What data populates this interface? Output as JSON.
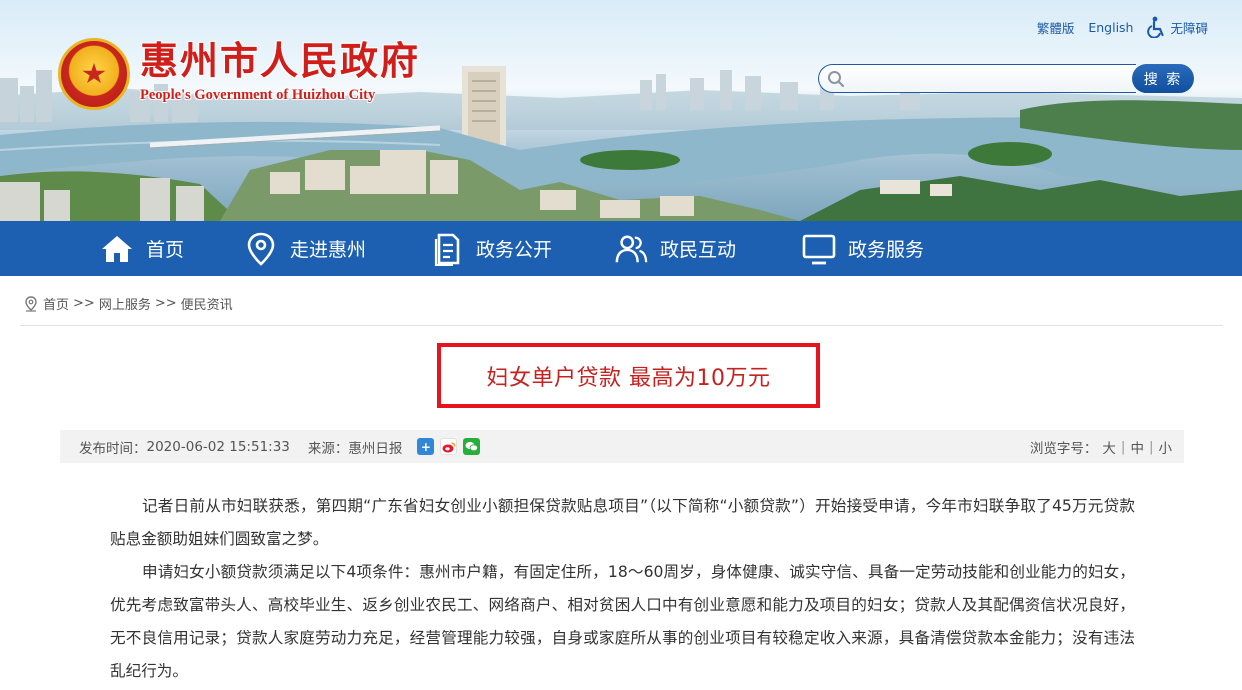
{
  "site": {
    "name_cn": "惠州市人民政府",
    "name_en": "People's Government of Huizhou City"
  },
  "toplinks": {
    "traditional": "繁體版",
    "english": "English",
    "accessibility": "无障碍"
  },
  "search": {
    "placeholder": "",
    "button_label": "搜 索"
  },
  "nav": {
    "items": [
      {
        "label": "首页",
        "icon": "home-icon"
      },
      {
        "label": "走进惠州",
        "icon": "location-pin-icon"
      },
      {
        "label": "政务公开",
        "icon": "document-icon"
      },
      {
        "label": "政民互动",
        "icon": "users-icon"
      },
      {
        "label": "政务服务",
        "icon": "monitor-icon"
      }
    ]
  },
  "breadcrumb": {
    "items": [
      "首页",
      "网上服务",
      "便民资讯"
    ],
    "separator": ">>"
  },
  "article": {
    "title": "妇女单户贷款 最高为10万元",
    "publish_label": "发布时间：",
    "publish_time": "2020-06-02 15:51:33",
    "source_label": "来源：",
    "source": "惠州日报",
    "font_size_label": "浏览字号：",
    "font_sizes": [
      "大",
      "中",
      "小"
    ],
    "paragraphs": [
      "记者日前从市妇联获悉，第四期“广东省妇女创业小额担保贷款贴息项目”（以下简称“小额贷款”）开始接受申请，今年市妇联争取了45万元贷款贴息金额助姐妹们圆致富之梦。",
      "申请妇女小额贷款须满足以下4项条件：惠州市户籍，有固定住所，18～60周岁，身体健康、诚实守信、具备一定劳动技能和创业能力的妇女，优先考虑致富带头人、高校毕业生、返乡创业农民工、网络商户、相对贫困人口中有创业意愿和能力及项目的妇女；贷款人及其配偶资信状况良好，无不良信用记录；贷款人家庭劳动力充足，经营管理能力较强，自身或家庭所从事的创业项目有较稳定收入来源，具备清偿贷款本金能力；没有违法乱纪行为。"
    ]
  },
  "colors": {
    "nav_bg": "#1d5fb0",
    "brand_red": "#d01e1a",
    "title_border": "#e6141d",
    "link_blue": "#1c5aa7"
  }
}
